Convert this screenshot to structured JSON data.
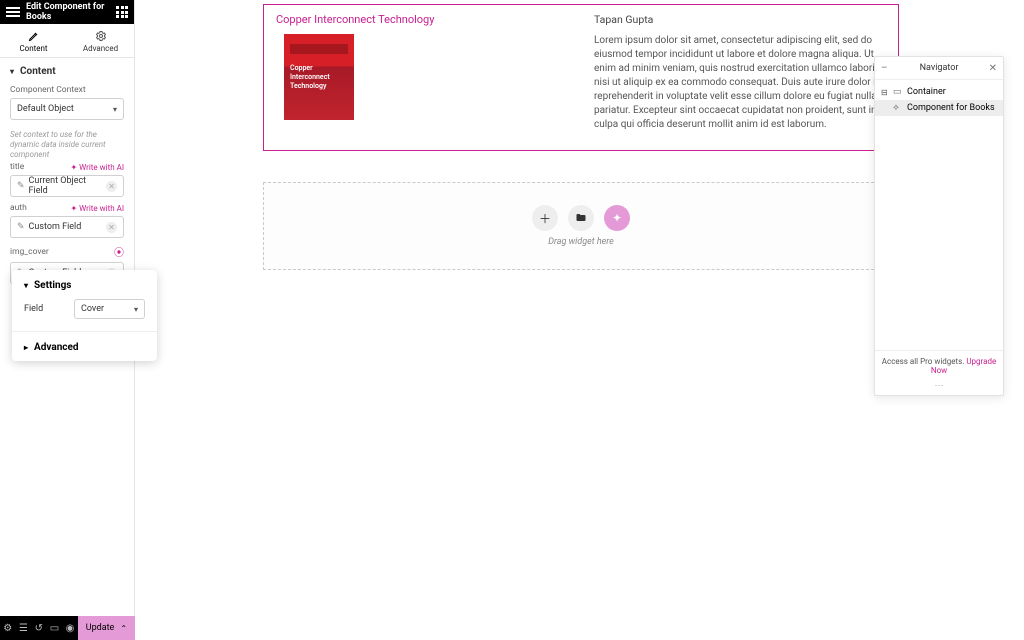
{
  "header": {
    "title": "Edit Component for Books"
  },
  "tabs": {
    "content": "Content",
    "advanced": "Advanced"
  },
  "content_section": {
    "heading": "Content",
    "context_label": "Component Context",
    "context_value": "Default Object",
    "context_hint": "Set context to use for the dynamic data inside current component",
    "ai_label": "Write with AI",
    "fields": [
      {
        "key": "title",
        "value": "Current Object Field",
        "show_ai": true,
        "show_clear": true,
        "show_dyn": false
      },
      {
        "key": "auth",
        "value": "Custom Field",
        "show_ai": true,
        "show_clear": true,
        "show_dyn": false
      },
      {
        "key": "img_cover",
        "value": "Custom Field",
        "show_ai": false,
        "show_clear": true,
        "show_dyn": true
      }
    ]
  },
  "popover": {
    "settings_heading": "Settings",
    "field_label": "Field",
    "field_value": "Cover",
    "advanced_heading": "Advanced"
  },
  "bottombar": {
    "update": "Update"
  },
  "canvas": {
    "title": "Copper Interconnect Technology",
    "cover_line1": "Copper",
    "cover_line2": "Interconnect",
    "cover_line3": "Technology",
    "author": "Tapan Gupta",
    "desc": "Lorem ipsum dolor sit amet, consectetur adipiscing elit, sed do eiusmod tempor incididunt ut labore et dolore magna aliqua. Ut enim ad minim veniam, quis nostrud exercitation ullamco laboris nisi ut aliquip ex ea commodo consequat. Duis aute irure dolor in reprehenderit in voluptate velit esse cillum dolore eu fugiat nulla pariatur. Excepteur sint occaecat cupidatat non proident, sunt in culpa qui officia deserunt mollit anim id est laborum.",
    "drop_label": "Drag widget here"
  },
  "navigator": {
    "title": "Navigator",
    "items": [
      {
        "label": "Container"
      },
      {
        "label": "Component for Books"
      }
    ],
    "footer_pre": "Access all Pro widgets.",
    "footer_link": "Upgrade Now"
  }
}
